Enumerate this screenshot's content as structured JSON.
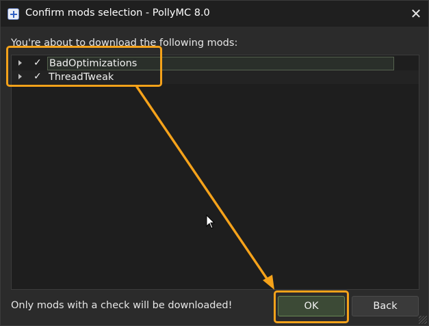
{
  "window": {
    "title": "Confirm mods selection - PollyMC 8.0",
    "close_glyph": "✕"
  },
  "intro_text": "You're about to download the following mods:",
  "mods": [
    {
      "name": "BadOptimizations",
      "checked": true,
      "check_glyph": "✓"
    },
    {
      "name": "ThreadTweak",
      "checked": true,
      "check_glyph": "✓"
    }
  ],
  "footer_note": "Only mods with a check will be downloaded!",
  "buttons": {
    "ok_label": "OK",
    "back_label": "Back"
  },
  "colors": {
    "annotation": "#f5a21a",
    "ok_button": "#3c4a36",
    "window_bg": "#2b2b2b"
  },
  "icons": {
    "app": "polly-plus-icon",
    "close": "close-icon",
    "expander": "triangle-right-icon",
    "check": "checkmark-icon",
    "cursor": "mouse-pointer-icon",
    "arrow": "annotation-arrow"
  }
}
